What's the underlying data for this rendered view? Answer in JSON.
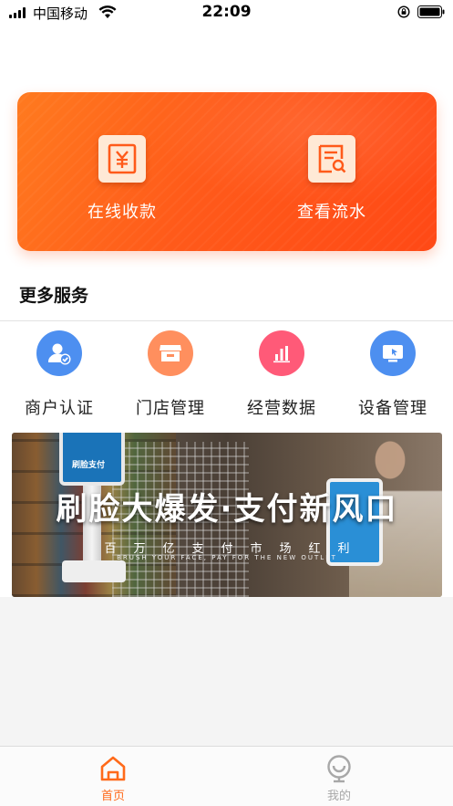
{
  "status_bar": {
    "carrier": "中国移动",
    "time": "22:09"
  },
  "top_card": {
    "left_action": {
      "label": "在线收款",
      "icon": "yuan-receipt-icon"
    },
    "right_action": {
      "label": "查看流水",
      "icon": "statement-search-icon"
    }
  },
  "more_services": {
    "title": "更多服务",
    "items": [
      {
        "label": "商户认证",
        "icon": "merchant-verify-icon",
        "color": "#4d8ff0"
      },
      {
        "label": "门店管理",
        "icon": "store-icon",
        "color": "#ff8f5e"
      },
      {
        "label": "经营数据",
        "icon": "bar-chart-icon",
        "color": "#ff5a78"
      },
      {
        "label": "设备管理",
        "icon": "device-icon",
        "color": "#4d8ff0"
      }
    ]
  },
  "promo_banner": {
    "headline": "刷脸大爆发·支付新风口",
    "subline": "百万亿支付市场红利",
    "english": "BRUSH YOUR FACE, PAY FOR THE NEW OUTLET",
    "device_left_text": "刷脸支付"
  },
  "tab_bar": {
    "tabs": [
      {
        "label": "首页",
        "icon": "home-icon",
        "active": true
      },
      {
        "label": "我的",
        "icon": "profile-icon",
        "active": false
      }
    ]
  },
  "colors": {
    "accent": "#ff6a1a",
    "card_gradient_start": "#ff7a1f",
    "card_gradient_end": "#ff4916"
  }
}
